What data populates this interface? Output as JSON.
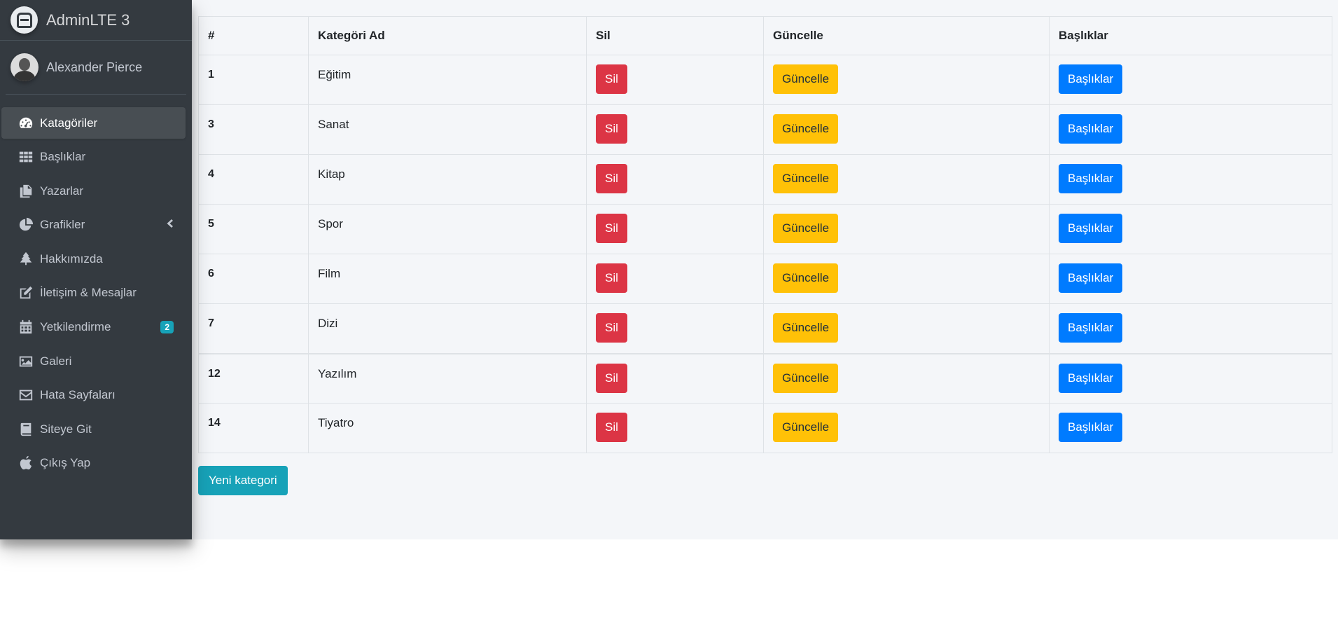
{
  "brand": {
    "name": "AdminLTE 3"
  },
  "user": {
    "name": "Alexander Pierce"
  },
  "sidebar": {
    "items": [
      {
        "label": "Katagöriler",
        "icon": "tachometer-icon",
        "active": true
      },
      {
        "label": "Başlıklar",
        "icon": "grid-icon"
      },
      {
        "label": "Yazarlar",
        "icon": "copy-icon"
      },
      {
        "label": "Grafikler",
        "icon": "pie-chart-icon",
        "chevron": "chevron-left-icon"
      },
      {
        "label": "Hakkımızda",
        "icon": "tree-icon"
      },
      {
        "label": "İletişim & Mesajlar",
        "icon": "edit-icon"
      },
      {
        "label": "Yetkilendirme",
        "icon": "calendar-icon",
        "badge": "2"
      },
      {
        "label": "Galeri",
        "icon": "image-icon"
      },
      {
        "label": "Hata Sayfaları",
        "icon": "envelope-icon"
      },
      {
        "label": "Siteye Git",
        "icon": "book-icon"
      },
      {
        "label": "Çıkış Yap",
        "icon": "apple-icon"
      }
    ]
  },
  "table": {
    "headers": [
      "#",
      "Kategöri Ad",
      "Sil",
      "Güncelle",
      "Başlıklar"
    ],
    "rows": [
      {
        "id": "1",
        "name": "Eğitim"
      },
      {
        "id": "3",
        "name": "Sanat"
      },
      {
        "id": "4",
        "name": "Kitap"
      },
      {
        "id": "5",
        "name": "Spor"
      },
      {
        "id": "6",
        "name": "Film"
      },
      {
        "id": "7",
        "name": "Dizi"
      },
      {
        "id": "12",
        "name": "Yazılım"
      },
      {
        "id": "14",
        "name": "Tiyatro"
      }
    ],
    "delete_label": "Sil",
    "update_label": "Güncelle",
    "titles_label": "Başlıklar"
  },
  "new_category_label": "Yeni kategori",
  "colors": {
    "sidebar_bg": "#343a40",
    "danger": "#dc3545",
    "warning": "#ffc107",
    "primary": "#007bff",
    "info": "#17a2b8"
  }
}
